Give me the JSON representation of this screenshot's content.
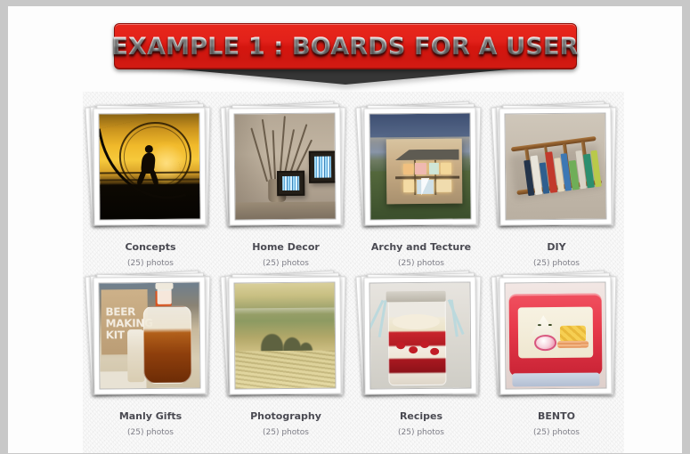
{
  "page": {
    "background_color": "#c8c8c8",
    "canvas_color": "#fdfdfd",
    "panel_texture_color": "#fbfbfb"
  },
  "banner": {
    "title": "EXAMPLE 1 : BOARDS FOR A USER",
    "fill_color": "#d4160f",
    "text_color": "#ffffff",
    "tail_color": "#2a2a2a"
  },
  "boards": {
    "title_color": "#4a4a52",
    "count_color": "#7d7d86",
    "rows": [
      {
        "items": [
          {
            "title": "Concepts",
            "count": "(25) photos",
            "art": "art-concepts"
          },
          {
            "title": "Home Decor",
            "count": "(25) photos",
            "art": "art-homedecor"
          },
          {
            "title": "Archy and Tecture",
            "count": "(25) photos",
            "art": "art-archy"
          },
          {
            "title": "DIY",
            "count": "(25) photos",
            "art": "art-diy"
          }
        ]
      },
      {
        "items": [
          {
            "title": "Manly Gifts",
            "count": "(25) photos",
            "art": "art-manly"
          },
          {
            "title": "Photography",
            "count": "(25) photos",
            "art": "art-photo"
          },
          {
            "title": "Recipes",
            "count": "(25) photos",
            "art": "art-recipes"
          },
          {
            "title": "BENTO",
            "count": "(25) photos",
            "art": "art-bento"
          }
        ]
      }
    ]
  },
  "art_details": {
    "manly_gifts_box_text": "BEER\nMAKING\nKIT"
  }
}
